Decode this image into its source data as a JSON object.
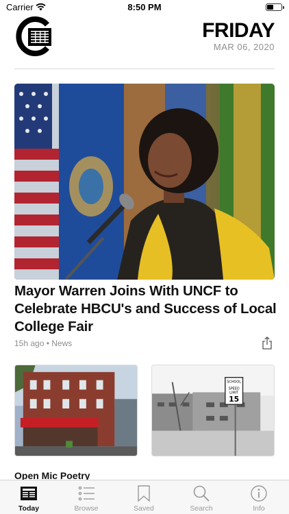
{
  "status_bar": {
    "carrier": "Carrier",
    "time": "8:50 PM"
  },
  "header": {
    "day": "FRIDAY",
    "date": "MAR 06, 2020"
  },
  "featured": {
    "headline": "Mayor Warren Joins With UNCF to Celebrate HBCU's and Success of Local College Fair",
    "meta": "15h ago • News"
  },
  "next_story": {
    "title": "Open Mic Poetry"
  },
  "tabs": [
    {
      "label": "Today",
      "icon": "newspaper-icon",
      "active": true
    },
    {
      "label": "Browse",
      "icon": "list-icon",
      "active": false
    },
    {
      "label": "Saved",
      "icon": "bookmark-icon",
      "active": false
    },
    {
      "label": "Search",
      "icon": "search-icon",
      "active": false
    },
    {
      "label": "Info",
      "icon": "info-icon",
      "active": false
    }
  ],
  "colors": {
    "accent": "#000000",
    "muted": "#8e8e93",
    "tab_inactive": "#999999"
  }
}
